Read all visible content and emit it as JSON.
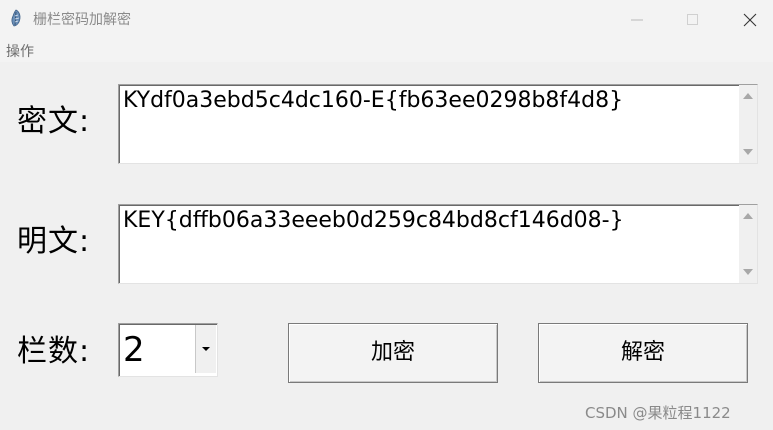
{
  "window": {
    "title": "栅栏密码加解密",
    "icon": "feather-app-icon"
  },
  "menu": {
    "items": [
      "操作"
    ]
  },
  "ciphertext": {
    "label": "密文:",
    "value": "KYdf0a3ebd5c4dc160-E{fb63ee0298b8f4d8}"
  },
  "plaintext": {
    "label": "明文:",
    "value": "KEY{dffb06a33eeeb0d259c84bd8cf146d08-}"
  },
  "rails": {
    "label": "栏数:",
    "value": "2"
  },
  "buttons": {
    "encrypt": "加密",
    "decrypt": "解密"
  },
  "watermark": "CSDN @果粒程1122"
}
